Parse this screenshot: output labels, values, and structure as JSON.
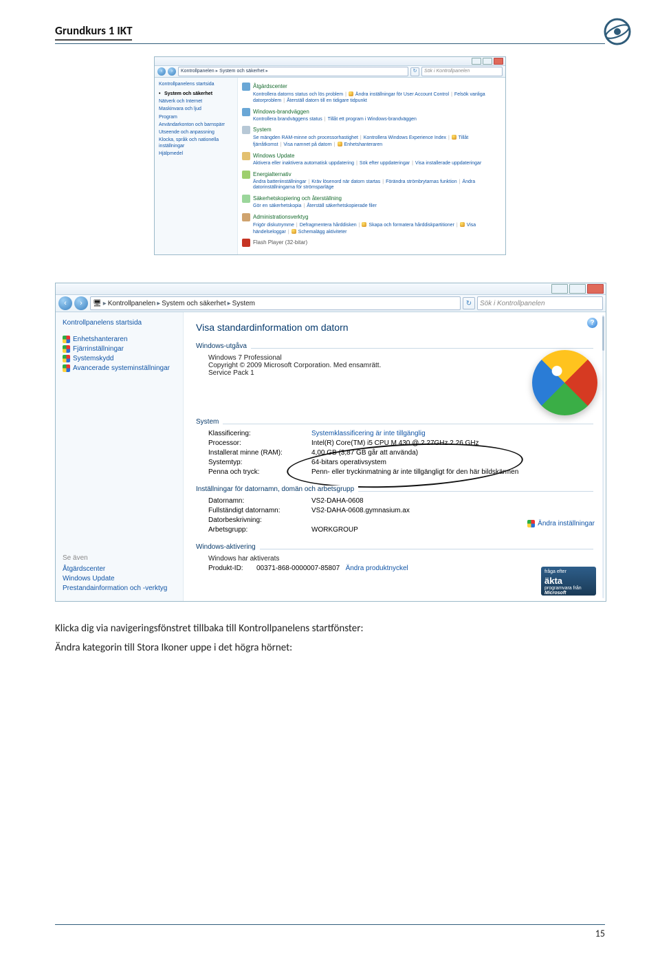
{
  "doc": {
    "header_title": "Grundkurs 1 IKT",
    "footer_page": "15",
    "para1": "Klicka dig via navigeringsfönstret tillbaka till Kontrollpanelens startfönster:",
    "para2": "Ändra kategorin till Stora Ikoner uppe i det högra hörnet:"
  },
  "shot1": {
    "breadcrumb": [
      "Kontrollpanelen",
      "System och säkerhet"
    ],
    "search_placeholder": "Sök i Kontrollpanelen",
    "side_home": "Kontrollpanelens startsida",
    "side_items": [
      {
        "label": "System och säkerhet",
        "current": true
      },
      {
        "label": "Nätverk och Internet"
      },
      {
        "label": "Maskinvara och ljud"
      },
      {
        "label": "Program"
      },
      {
        "label": "Användarkonton och barnspärr"
      },
      {
        "label": "Utseende och anpassning"
      },
      {
        "label": "Klocka, språk och nationella inställningar"
      },
      {
        "label": "Hjälpmedel"
      }
    ],
    "cats": [
      {
        "title": "Åtgärdscenter",
        "icon": "blue",
        "links": [
          "Kontrollera datorns status och lös problem",
          "🛡 Ändra inställningar för User Account Control",
          "Felsök vanliga datorproblem",
          "Återställ datorn till en tidigare tidpunkt"
        ]
      },
      {
        "title": "Windows-brandväggen",
        "icon": "blue",
        "links": [
          "Kontrollera brandväggens status",
          "Tillåt ett program i Windows-brandväggen"
        ]
      },
      {
        "title": "System",
        "icon": "pc",
        "links": [
          "Se mängden RAM-minne och processorhastighet",
          "Kontrollera Windows Experience Index",
          "🛡 Tillåt fjärråtkomst",
          "Visa namnet på datorn",
          "🛡 Enhetshanteraren"
        ]
      },
      {
        "title": "Windows Update",
        "icon": "glb",
        "links": [
          "Aktivera eller inaktivera automatisk uppdatering",
          "Sök efter uppdateringar",
          "Visa installerade uppdateringar"
        ]
      },
      {
        "title": "Energialternativ",
        "icon": "batt",
        "links": [
          "Ändra batteriinställningar",
          "Kräv lösenord när datorn startas",
          "Förändra strömbrytarnas funktion",
          "Ändra datorinställningarna för strömsparläge"
        ]
      },
      {
        "title": "Säkerhetskopiering och återställning",
        "icon": "bak",
        "links": [
          "Gör en säkerhetskopia",
          "Återställ säkerhetskopierade filer"
        ]
      },
      {
        "title": "Administrationsverktyg",
        "icon": "admin",
        "links": [
          "Frigör diskutrymme",
          "Defragmentera hårddisken",
          "🛡 Skapa och formatera hårddiskpartitioner",
          "🛡 Visa händelseloggar",
          "🛡 Schemalägg aktiviteter"
        ]
      },
      {
        "title": "Flash Player (32-bitar)",
        "icon": "flash",
        "flash": true,
        "links": []
      }
    ]
  },
  "shot2": {
    "breadcrumb": [
      "Kontrollpanelen",
      "System och säkerhet",
      "System"
    ],
    "search_placeholder": "Sök i Kontrollpanelen",
    "side_home": "Kontrollpanelens startsida",
    "side_items": [
      "Enhetshanteraren",
      "Fjärrinställningar",
      "Systemskydd",
      "Avancerade systeminställningar"
    ],
    "see_also_label": "Se även",
    "see_also": [
      "Åtgärdscenter",
      "Windows Update",
      "Prestandainformation och -verktyg"
    ],
    "heading": "Visa standardinformation om datorn",
    "edition_group": "Windows-utgåva",
    "edition_lines": [
      "Windows 7 Professional",
      "Copyright © 2009 Microsoft Corporation. Med ensamrätt.",
      "Service Pack 1"
    ],
    "system_group": "System",
    "system_kv": [
      {
        "k": "Klassificering:",
        "v": "Systemklassificering är inte tillgänglig",
        "link": true
      },
      {
        "k": "Processor:",
        "v": "Intel(R) Core(TM) i5 CPU       M 430  @ 2.27GHz  2.26 GHz"
      },
      {
        "k": "Installerat minne (RAM):",
        "v": "4,00 GB (3,87 GB går att använda)"
      },
      {
        "k": "Systemtyp:",
        "v": "64-bitars operativsystem"
      },
      {
        "k": "Penna och tryck:",
        "v": "Penn- eller tryckinmatning är inte tillgängligt för den här bildskärmen"
      }
    ],
    "names_group": "Inställningar för datornamn, domän och arbetsgrupp",
    "names_kv": [
      {
        "k": "Datornamn:",
        "v": "VS2-DAHA-0608"
      },
      {
        "k": "Fullständigt datornamn:",
        "v": "VS2-DAHA-0608.gymnasium.ax"
      },
      {
        "k": "Datorbeskrivning:",
        "v": ""
      },
      {
        "k": "Arbetsgrupp:",
        "v": "WORKGROUP"
      }
    ],
    "change_settings": "Ändra inställningar",
    "activation_group": "Windows-aktivering",
    "activation_line": "Windows har aktiverats",
    "product_id_k": "Produkt-ID:",
    "product_id_v": "00371-868-0000007-85807",
    "change_key": "Ändra produktnyckel",
    "akta": {
      "top": "fråga efter",
      "mid": "äkta",
      "bot1": "programvara från",
      "bot2": "Microsoft"
    }
  }
}
